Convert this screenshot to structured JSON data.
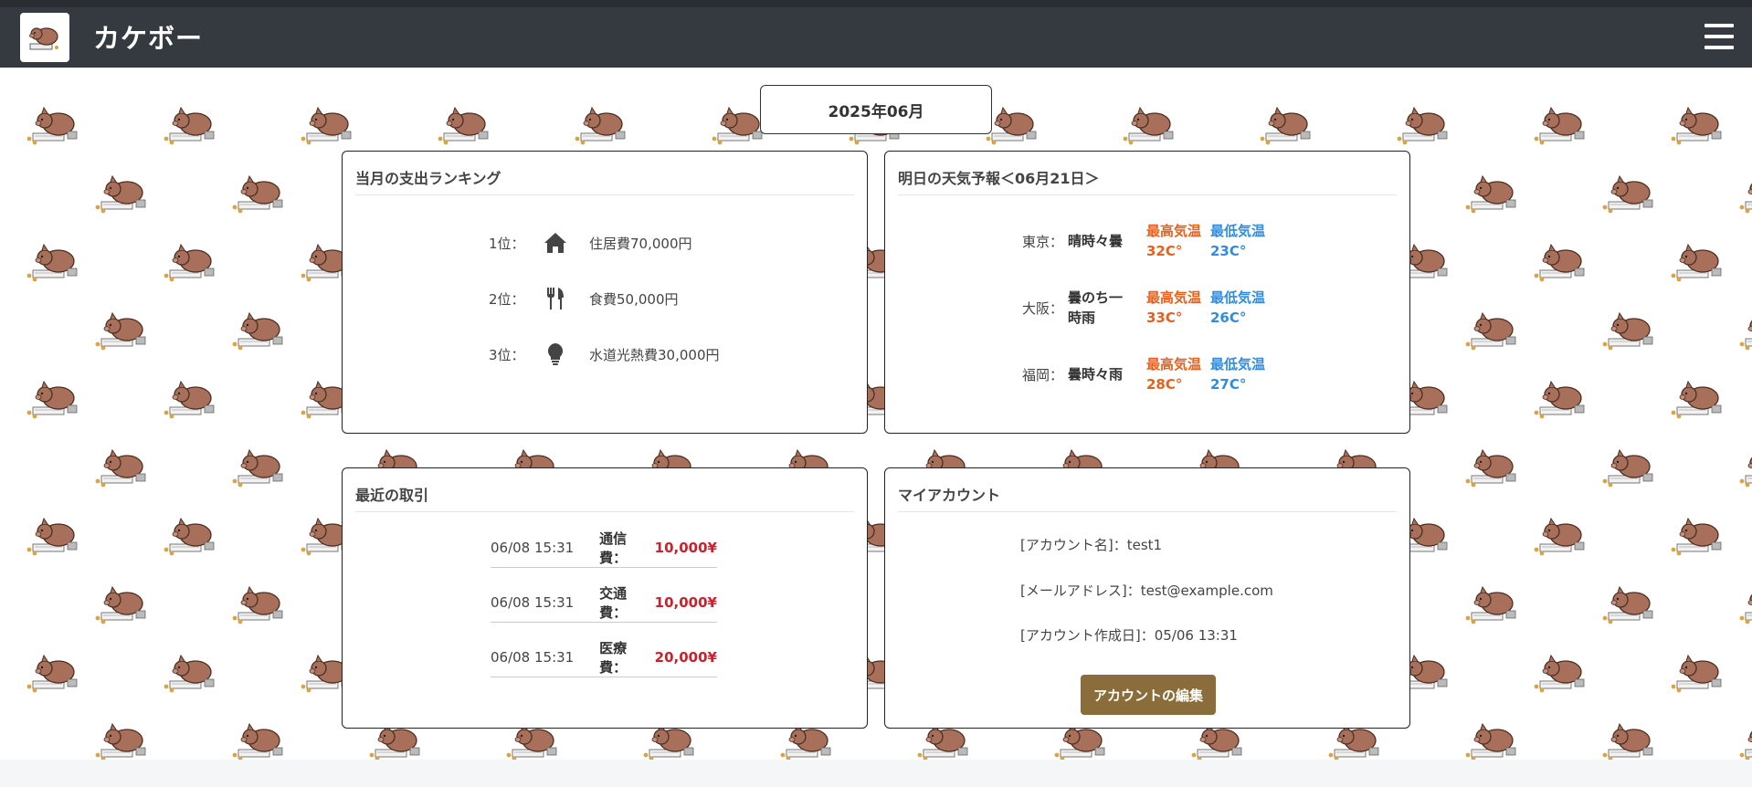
{
  "app": {
    "brand": "カケボー"
  },
  "month_selector": {
    "value": "2025年06月"
  },
  "ranking": {
    "title": "当月の支出ランキング",
    "items": [
      {
        "rank": "1位：",
        "icon": "home-icon",
        "text": "住居費70,000円"
      },
      {
        "rank": "2位：",
        "icon": "utensils-icon",
        "text": "食費50,000円"
      },
      {
        "rank": "3位：",
        "icon": "lightbulb-icon",
        "text": "水道光熱費30,000円"
      }
    ]
  },
  "weather": {
    "title": "明日の天気予報＜06月21日＞",
    "high_label": "最高気温",
    "low_label": "最低気温",
    "cities": [
      {
        "city": "東京：",
        "cond_line1": "晴時々曇",
        "cond_line2": "",
        "high": "32C°",
        "low": "23C°"
      },
      {
        "city": "大阪：",
        "cond_line1": "曇のち一",
        "cond_line2": "時雨",
        "high": "33C°",
        "low": "26C°"
      },
      {
        "city": "福岡：",
        "cond_line1": "曇時々雨",
        "cond_line2": "",
        "high": "28C°",
        "low": "27C°"
      }
    ],
    "colors": {
      "high": "#e8601c",
      "low": "#2f8ce0"
    }
  },
  "transactions": {
    "title": "最近の取引",
    "items": [
      {
        "datetime": "06/08 15:31",
        "category": "通信費：",
        "amount": "10,000¥"
      },
      {
        "datetime": "06/08 15:31",
        "category": "交通費：",
        "amount": "10,000¥"
      },
      {
        "datetime": "06/08 15:31",
        "category": "医療費：",
        "amount": "20,000¥"
      }
    ],
    "amount_color": "#c8232c"
  },
  "account": {
    "title": "マイアカウント",
    "name_line": "[アカウント名]：test1",
    "email_line": "[メールアドレス]：test@example.com",
    "created_line": "[アカウント作成日]：05/06 13:31",
    "edit_button": "アカウントの編集",
    "button_color": "#8a6d3b"
  }
}
